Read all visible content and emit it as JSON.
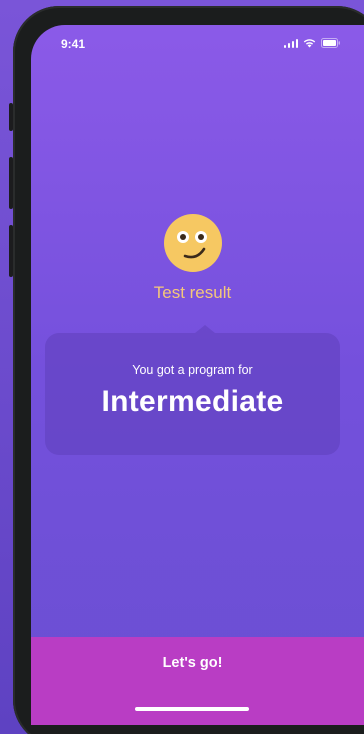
{
  "status_bar": {
    "time": "9:41",
    "icons": [
      "signal-icon",
      "wifi-icon",
      "battery-icon"
    ]
  },
  "result": {
    "emoji_icon": "smiley-face-icon",
    "label": "Test result",
    "subtitle": "You got a program for",
    "level": "Intermediate"
  },
  "cta": {
    "label": "Let's go!"
  },
  "colors": {
    "background_top": "#8b5ae8",
    "background_bottom": "#6a4fd2",
    "accent_label": "#f4c77a",
    "cta_background": "#b93dc4",
    "emoji_face": "#f6c862"
  }
}
